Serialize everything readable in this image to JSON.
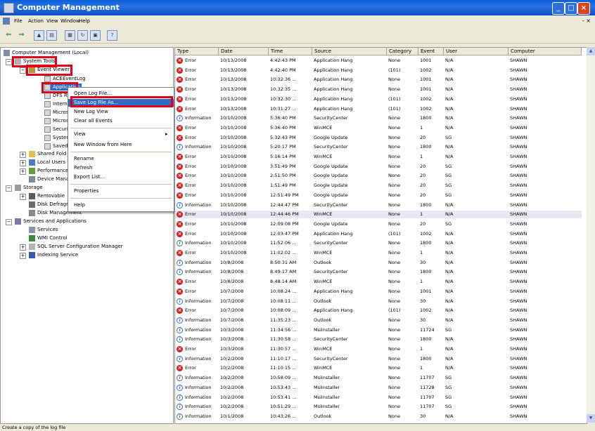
{
  "window": {
    "title": "Computer Management"
  },
  "menu": [
    "File",
    "Action",
    "View",
    "Window",
    "Help"
  ],
  "winctl": "- ×",
  "tree": {
    "root": "Computer Management (Local)",
    "system_tools": "System Tools",
    "event_viewer": "Event Viewer",
    "application": "Application",
    "children": [
      "ACEEventLog",
      "Application",
      "DFS Repl",
      "Internet",
      "Microsoft",
      "Microsoft",
      "Security",
      "System",
      "Saved"
    ],
    "items": [
      "Shared Fold",
      "Local Users",
      "Performance",
      "Device Mana",
      "Storage",
      "Removable",
      "Disk Defragm",
      "Disk Management",
      "Services and Applications",
      "Services",
      "WMI Control",
      "SQL Server Configuration Manager",
      "Indexing Service"
    ]
  },
  "context_menu": [
    "Open Log File...",
    "Save Log File As...",
    "New Log View",
    "Clear all Events",
    "View",
    "New Window from Here",
    "Rename",
    "Refresh",
    "Export List...",
    "Properties",
    "Help"
  ],
  "columns": [
    "Type",
    "Date",
    "Time",
    "Source",
    "Category",
    "Event",
    "User",
    "Computer"
  ],
  "events": [
    {
      "type": "Error",
      "date": "10/13/2008",
      "time": "4:42:43 PM",
      "source": "Application Hang",
      "category": "None",
      "event": "1001",
      "user": "N/A",
      "computer": "SHAWN"
    },
    {
      "type": "Error",
      "date": "10/13/2008",
      "time": "4:42:40 PM",
      "source": "Application Hang",
      "category": "(101)",
      "event": "1002",
      "user": "N/A",
      "computer": "SHAWN"
    },
    {
      "type": "Error",
      "date": "10/13/2008",
      "time": "10:32:36 ...",
      "source": "Application Hang",
      "category": "None",
      "event": "1001",
      "user": "N/A",
      "computer": "SHAWN"
    },
    {
      "type": "Error",
      "date": "10/13/2008",
      "time": "10:32:35 ...",
      "source": "Application Hang",
      "category": "None",
      "event": "1001",
      "user": "N/A",
      "computer": "SHAWN"
    },
    {
      "type": "Error",
      "date": "10/13/2008",
      "time": "10:32:30 ...",
      "source": "Application Hang",
      "category": "(101)",
      "event": "1002",
      "user": "N/A",
      "computer": "SHAWN"
    },
    {
      "type": "Error",
      "date": "10/13/2008",
      "time": "10:31:27 ...",
      "source": "Application Hang",
      "category": "(101)",
      "event": "1002",
      "user": "N/A",
      "computer": "SHAWN"
    },
    {
      "type": "Information",
      "date": "10/10/2008",
      "time": "5:36:40 PM",
      "source": "SecurityCenter",
      "category": "None",
      "event": "1800",
      "user": "N/A",
      "computer": "SHAWN"
    },
    {
      "type": "Error",
      "date": "10/10/2008",
      "time": "5:36:40 PM",
      "source": "WinMCE",
      "category": "None",
      "event": "1",
      "user": "N/A",
      "computer": "SHAWN"
    },
    {
      "type": "Error",
      "date": "10/10/2008",
      "time": "5:32:43 PM",
      "source": "Google Update",
      "category": "None",
      "event": "20",
      "user": "SG",
      "computer": "SHAWN"
    },
    {
      "type": "Information",
      "date": "10/10/2008",
      "time": "5:20:17 PM",
      "source": "SecurityCenter",
      "category": "None",
      "event": "1800",
      "user": "N/A",
      "computer": "SHAWN"
    },
    {
      "type": "Error",
      "date": "10/10/2008",
      "time": "5:16:14 PM",
      "source": "WinMCE",
      "category": "None",
      "event": "1",
      "user": "N/A",
      "computer": "SHAWN"
    },
    {
      "type": "Error",
      "date": "10/10/2008",
      "time": "3:51:49 PM",
      "source": "Google Update",
      "category": "None",
      "event": "20",
      "user": "SG",
      "computer": "SHAWN"
    },
    {
      "type": "Error",
      "date": "10/10/2008",
      "time": "2:51:50 PM",
      "source": "Google Update",
      "category": "None",
      "event": "20",
      "user": "SG",
      "computer": "SHAWN"
    },
    {
      "type": "Error",
      "date": "10/10/2008",
      "time": "1:51:49 PM",
      "source": "Google Update",
      "category": "None",
      "event": "20",
      "user": "SG",
      "computer": "SHAWN"
    },
    {
      "type": "Error",
      "date": "10/10/2008",
      "time": "12:51:49 PM",
      "source": "Google Update",
      "category": "None",
      "event": "20",
      "user": "SG",
      "computer": "SHAWN"
    },
    {
      "type": "Information",
      "date": "10/10/2008",
      "time": "12:44:47 PM",
      "source": "SecurityCenter",
      "category": "None",
      "event": "1800",
      "user": "N/A",
      "computer": "SHAWN"
    },
    {
      "type": "Error",
      "date": "10/10/2008",
      "time": "12:44:46 PM",
      "source": "WinMCE",
      "category": "None",
      "event": "1",
      "user": "N/A",
      "computer": "SHAWN"
    },
    {
      "type": "Error",
      "date": "10/10/2008",
      "time": "12:09:08 PM",
      "source": "Google Update",
      "category": "None",
      "event": "20",
      "user": "SG",
      "computer": "SHAWN"
    },
    {
      "type": "Error",
      "date": "10/10/2008",
      "time": "12:03:47 PM",
      "source": "Application Hang",
      "category": "(101)",
      "event": "1002",
      "user": "N/A",
      "computer": "SHAWN"
    },
    {
      "type": "Information",
      "date": "10/10/2008",
      "time": "11:52:06 ...",
      "source": "SecurityCenter",
      "category": "None",
      "event": "1800",
      "user": "N/A",
      "computer": "SHAWN"
    },
    {
      "type": "Error",
      "date": "10/10/2008",
      "time": "11:02:02 ...",
      "source": "WinMCE",
      "category": "None",
      "event": "1",
      "user": "N/A",
      "computer": "SHAWN"
    },
    {
      "type": "Information",
      "date": "10/8/2008",
      "time": "8:50:31 AM",
      "source": "Outlook",
      "category": "None",
      "event": "30",
      "user": "N/A",
      "computer": "SHAWN"
    },
    {
      "type": "Information",
      "date": "10/8/2008",
      "time": "8:49:17 AM",
      "source": "SecurityCenter",
      "category": "None",
      "event": "1800",
      "user": "N/A",
      "computer": "SHAWN"
    },
    {
      "type": "Error",
      "date": "10/8/2008",
      "time": "8:48:14 AM",
      "source": "WinMCE",
      "category": "None",
      "event": "1",
      "user": "N/A",
      "computer": "SHAWN"
    },
    {
      "type": "Error",
      "date": "10/7/2008",
      "time": "10:08:24 ...",
      "source": "Application Hang",
      "category": "None",
      "event": "1001",
      "user": "N/A",
      "computer": "SHAWN"
    },
    {
      "type": "Information",
      "date": "10/7/2008",
      "time": "10:08:11 ...",
      "source": "Outlook",
      "category": "None",
      "event": "30",
      "user": "N/A",
      "computer": "SHAWN"
    },
    {
      "type": "Error",
      "date": "10/7/2008",
      "time": "10:08:09 ...",
      "source": "Application Hang",
      "category": "(101)",
      "event": "1002",
      "user": "N/A",
      "computer": "SHAWN"
    },
    {
      "type": "Information",
      "date": "10/7/2008",
      "time": "11:35:23 ...",
      "source": "Outlook",
      "category": "None",
      "event": "30",
      "user": "N/A",
      "computer": "SHAWN"
    },
    {
      "type": "Information",
      "date": "10/3/2008",
      "time": "11:34:56 ...",
      "source": "MsiInstaller",
      "category": "None",
      "event": "11724",
      "user": "SG",
      "computer": "SHAWN"
    },
    {
      "type": "Information",
      "date": "10/3/2008",
      "time": "11:30:58 ...",
      "source": "SecurityCenter",
      "category": "None",
      "event": "1800",
      "user": "N/A",
      "computer": "SHAWN"
    },
    {
      "type": "Error",
      "date": "10/3/2008",
      "time": "11:30:57 ...",
      "source": "WinMCE",
      "category": "None",
      "event": "1",
      "user": "N/A",
      "computer": "SHAWN"
    },
    {
      "type": "Information",
      "date": "10/2/2008",
      "time": "11:10:17 ...",
      "source": "SecurityCenter",
      "category": "None",
      "event": "1800",
      "user": "N/A",
      "computer": "SHAWN"
    },
    {
      "type": "Error",
      "date": "10/2/2008",
      "time": "11:10:15 ...",
      "source": "WinMCE",
      "category": "None",
      "event": "1",
      "user": "N/A",
      "computer": "SHAWN"
    },
    {
      "type": "Information",
      "date": "10/2/2008",
      "time": "10:58:09 ...",
      "source": "MsiInstaller",
      "category": "None",
      "event": "11707",
      "user": "SG",
      "computer": "SHAWN"
    },
    {
      "type": "Information",
      "date": "10/2/2008",
      "time": "10:53:43 ...",
      "source": "MsiInstaller",
      "category": "None",
      "event": "11728",
      "user": "SG",
      "computer": "SHAWN"
    },
    {
      "type": "Information",
      "date": "10/2/2008",
      "time": "10:53:41 ...",
      "source": "MsiInstaller",
      "category": "None",
      "event": "11707",
      "user": "SG",
      "computer": "SHAWN"
    },
    {
      "type": "Information",
      "date": "10/2/2008",
      "time": "10:51:29 ...",
      "source": "MsiInstaller",
      "category": "None",
      "event": "11707",
      "user": "SG",
      "computer": "SHAWN"
    },
    {
      "type": "Information",
      "date": "10/1/2008",
      "time": "10:43:26 ...",
      "source": "Outlook",
      "category": "None",
      "event": "30",
      "user": "N/A",
      "computer": "SHAWN"
    }
  ],
  "status": "Create a copy of the log file"
}
